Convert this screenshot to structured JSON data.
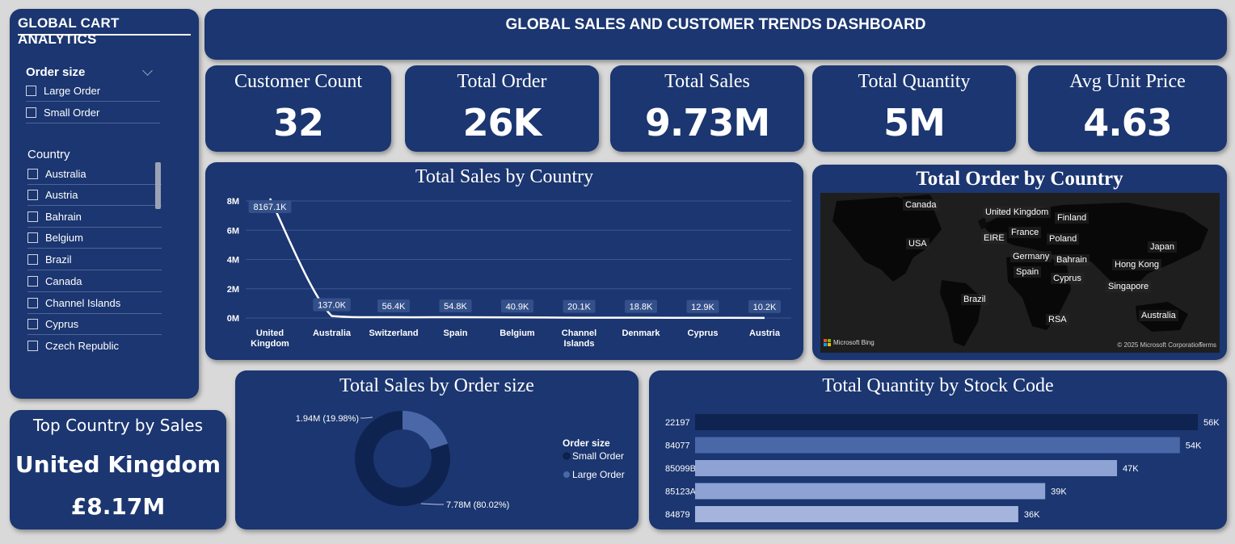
{
  "header": {
    "title": "GLOBAL SALES AND CUSTOMER TRENDS DASHBOARD"
  },
  "sidebar": {
    "brand": "GLOBAL CART ANALYTICS",
    "order_size": {
      "title": "Order size",
      "items": [
        "Large Order",
        "Small Order"
      ]
    },
    "country": {
      "title": "Country",
      "items": [
        "Australia",
        "Austria",
        "Bahrain",
        "Belgium",
        "Brazil",
        "Canada",
        "Channel Islands",
        "Cyprus",
        "Czech Republic"
      ]
    }
  },
  "kpis": [
    {
      "label": "Customer Count",
      "value": "32"
    },
    {
      "label": "Total Order",
      "value": "26K"
    },
    {
      "label": "Total Sales",
      "value": "9.73M"
    },
    {
      "label": "Total Quantity",
      "value": "5M"
    },
    {
      "label": "Avg Unit Price",
      "value": "4.63"
    }
  ],
  "top_country": {
    "title": "Top Country by Sales",
    "name": "United Kingdom",
    "value": "£8.17M"
  },
  "map": {
    "title": "Total Order by Country",
    "labels": [
      "Canada",
      "United Kingdom",
      "Finland",
      "USA",
      "EIRE",
      "France",
      "Poland",
      "Japan",
      "Germany",
      "Bahrain",
      "Hong Kong",
      "Spain",
      "Cyprus",
      "Singapore",
      "Brazil",
      "Australia",
      "RSA"
    ],
    "provider": "Microsoft Bing",
    "copyright": "© 2025 Microsoft Corporation",
    "terms": "Terms"
  },
  "colors": {
    "card": "#1b3670",
    "small_order": "#0f2350",
    "large_order": "#4a68a8",
    "bar_dark": "#0f2350",
    "bar_mid": "#4a68a8",
    "bar_light": "#8ea3d4"
  },
  "chart_data": [
    {
      "type": "line",
      "title": "Total Sales by Country",
      "categories": [
        "United Kingdom",
        "Australia",
        "Switzerland",
        "Spain",
        "Belgium",
        "Channel Islands",
        "Denmark",
        "Cyprus",
        "Austria"
      ],
      "values": [
        8167100,
        137000,
        56400,
        54800,
        40900,
        20100,
        18800,
        12900,
        10200
      ],
      "data_labels": [
        "8167.1K",
        "137.0K",
        "56.4K",
        "54.8K",
        "40.9K",
        "20.1K",
        "18.8K",
        "12.9K",
        "10.2K"
      ],
      "yticks": [
        "0M",
        "2M",
        "4M",
        "6M",
        "8M"
      ],
      "ylim": [
        0,
        8000000
      ],
      "grid": true
    },
    {
      "type": "pie",
      "title": "Total Sales by Order size",
      "legend_title": "Order size",
      "legend_position": "right",
      "series": [
        {
          "name": "Small Order",
          "value": 7.78,
          "percent": 80.02,
          "label": "7.78M (80.02%)"
        },
        {
          "name": "Large Order",
          "value": 1.94,
          "percent": 19.98,
          "label": "1.94M (19.98%)"
        }
      ]
    },
    {
      "type": "bar",
      "title": "Total Quantity by Stock Code",
      "categories": [
        "22197",
        "84077",
        "85099B",
        "85123A",
        "84879"
      ],
      "values": [
        56,
        54,
        47,
        39,
        36
      ],
      "data_labels": [
        "56K",
        "54K",
        "47K",
        "39K",
        "36K"
      ],
      "orientation": "horizontal"
    }
  ]
}
